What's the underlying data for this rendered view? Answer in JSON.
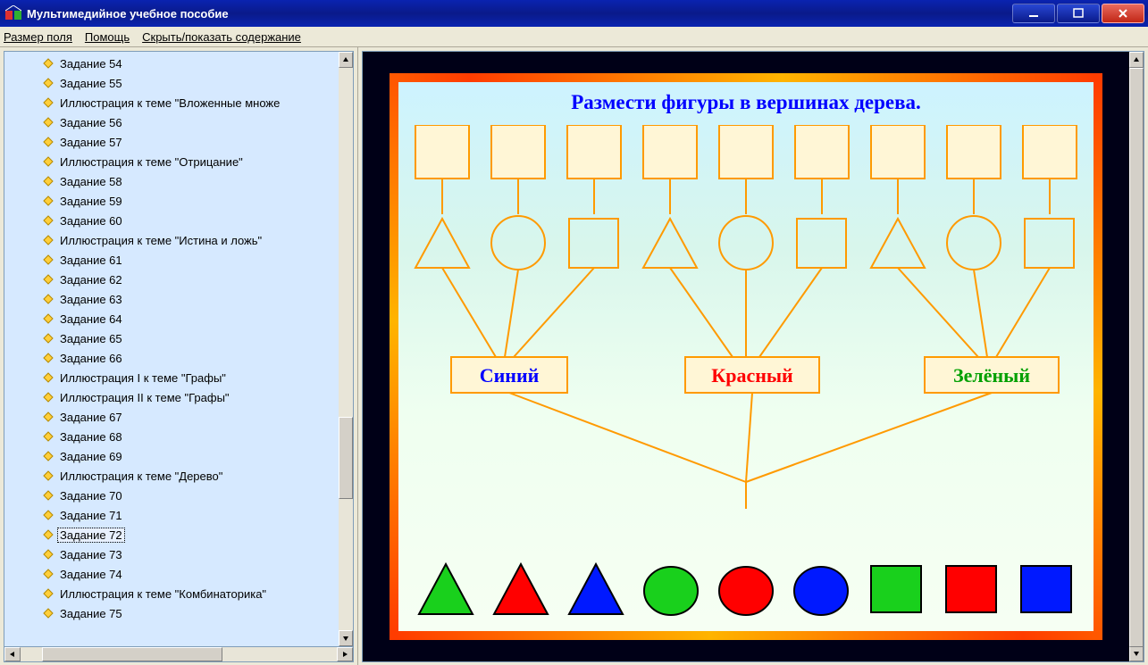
{
  "window": {
    "title": "Мультимедийное учебное пособие"
  },
  "menu": {
    "items": [
      "Размер поля",
      "Помощь",
      "Скрыть/показать содержание"
    ]
  },
  "sidebar": {
    "selected_index": 24,
    "items": [
      "Задание 54",
      "Задание 55",
      "Иллюстрация к теме \"Вложенные множе",
      "Задание 56",
      "Задание 57",
      "Иллюстрация к теме \"Отрицание\"",
      "Задание 58",
      "Задание 59",
      "Задание 60",
      "Иллюстрация к теме \"Истина и ложь\"",
      "Задание 61",
      "Задание 62",
      "Задание 63",
      "Задание 64",
      "Задание 65",
      "Задание 66",
      "Иллюстрация I к теме \"Графы\"",
      "Иллюстрация II к теме \"Графы\"",
      "Задание 67",
      "Задание 68",
      "Задание 69",
      "Иллюстрация к теме \"Дерево\"",
      "Задание 70",
      "Задание 71",
      "Задание 72",
      "Задание 73",
      "Задание 74",
      "Иллюстрация к теме \"Комбинаторика\"",
      "Задание 75"
    ]
  },
  "exercise": {
    "title": "Размести фигуры в вершинах дерева.",
    "color_labels": {
      "blue": "Синий",
      "red": "Красный",
      "green": "Зелёный"
    },
    "palette_shapes": [
      {
        "shape": "triangle",
        "color": "#19d01c"
      },
      {
        "shape": "triangle",
        "color": "#ff0000"
      },
      {
        "shape": "triangle",
        "color": "#0019ff"
      },
      {
        "shape": "circle",
        "color": "#19d01c"
      },
      {
        "shape": "circle",
        "color": "#ff0000"
      },
      {
        "shape": "circle",
        "color": "#0019ff"
      },
      {
        "shape": "square",
        "color": "#19d01c"
      },
      {
        "shape": "square",
        "color": "#ff0000"
      },
      {
        "shape": "square",
        "color": "#0019ff"
      }
    ]
  }
}
